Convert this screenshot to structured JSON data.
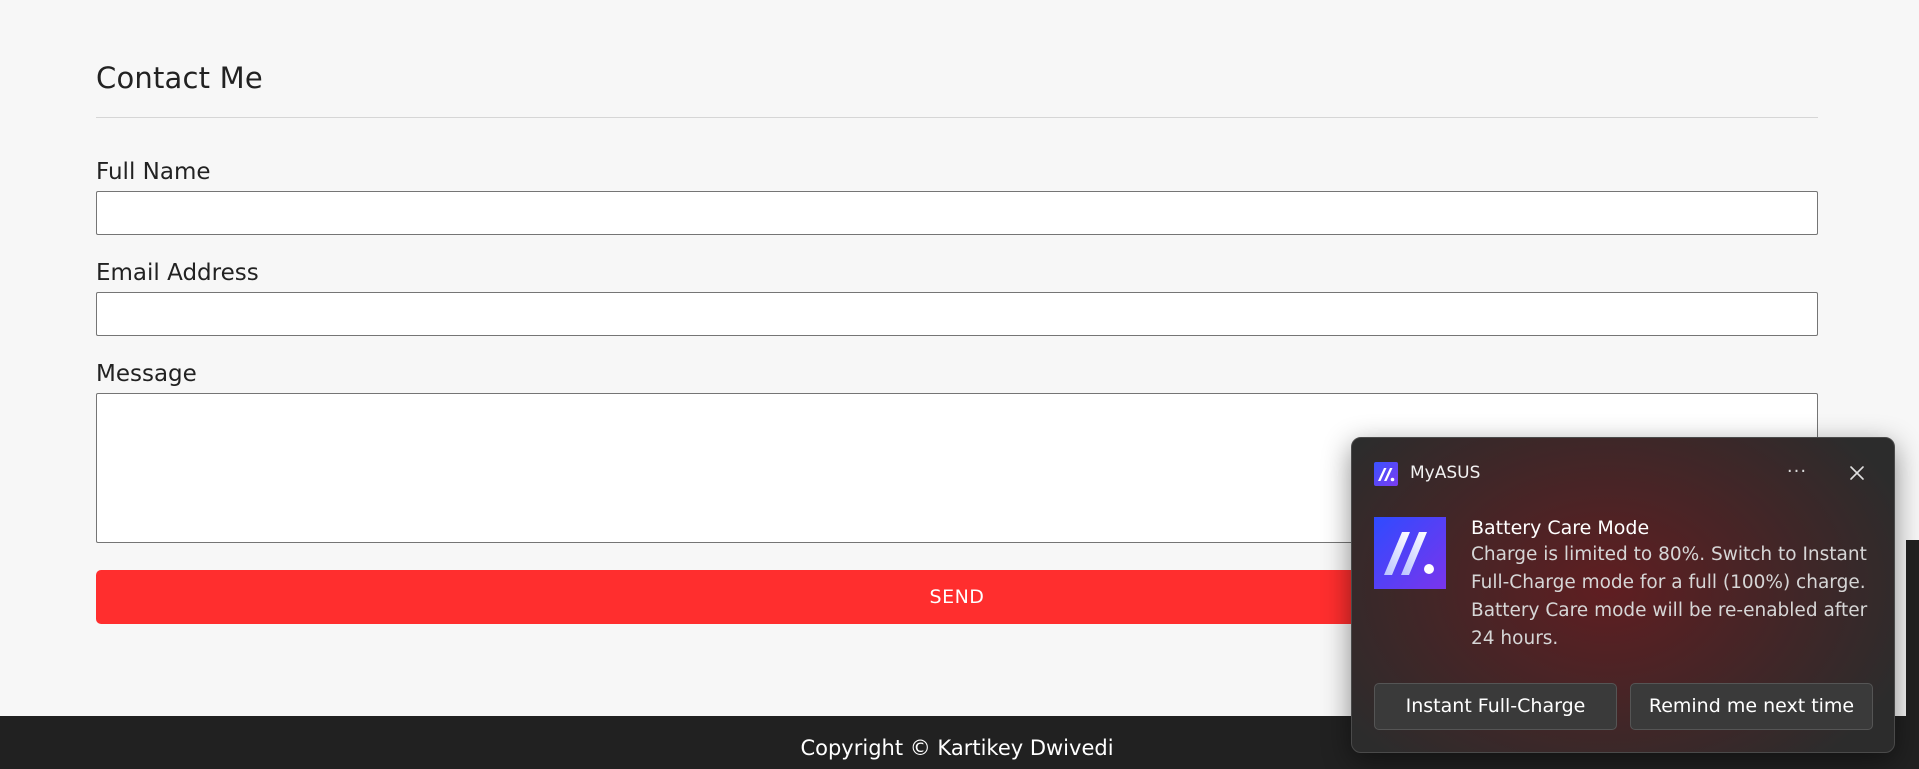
{
  "contact": {
    "heading": "Contact Me",
    "fields": {
      "name_label": "Full Name",
      "email_label": "Email Address",
      "message_label": "Message"
    },
    "send_label": "SEND"
  },
  "footer": {
    "copyright": "Copyright © Kartikey Dwivedi"
  },
  "toast": {
    "app_name": "MyASUS",
    "more_label": "···",
    "title": "Battery Care Mode",
    "body": "Charge is limited to 80%. Switch to Instant Full-Charge mode for a full (100%) charge. Battery Care mode will be re-enabled after 24 hours.",
    "buttons": {
      "primary": "Instant Full-Charge",
      "secondary": "Remind me next time"
    },
    "icons": {
      "app": "myasus-icon",
      "more": "more-options-icon",
      "close": "close-icon"
    }
  },
  "colors": {
    "page_bg": "#f7f7f7",
    "send_button": "#ff2e2e",
    "footer_bg": "#212121",
    "toast_bg": "#2c2c2c",
    "toast_glow": "#6e1a1e",
    "myasus_blue": "#3d5bff"
  }
}
